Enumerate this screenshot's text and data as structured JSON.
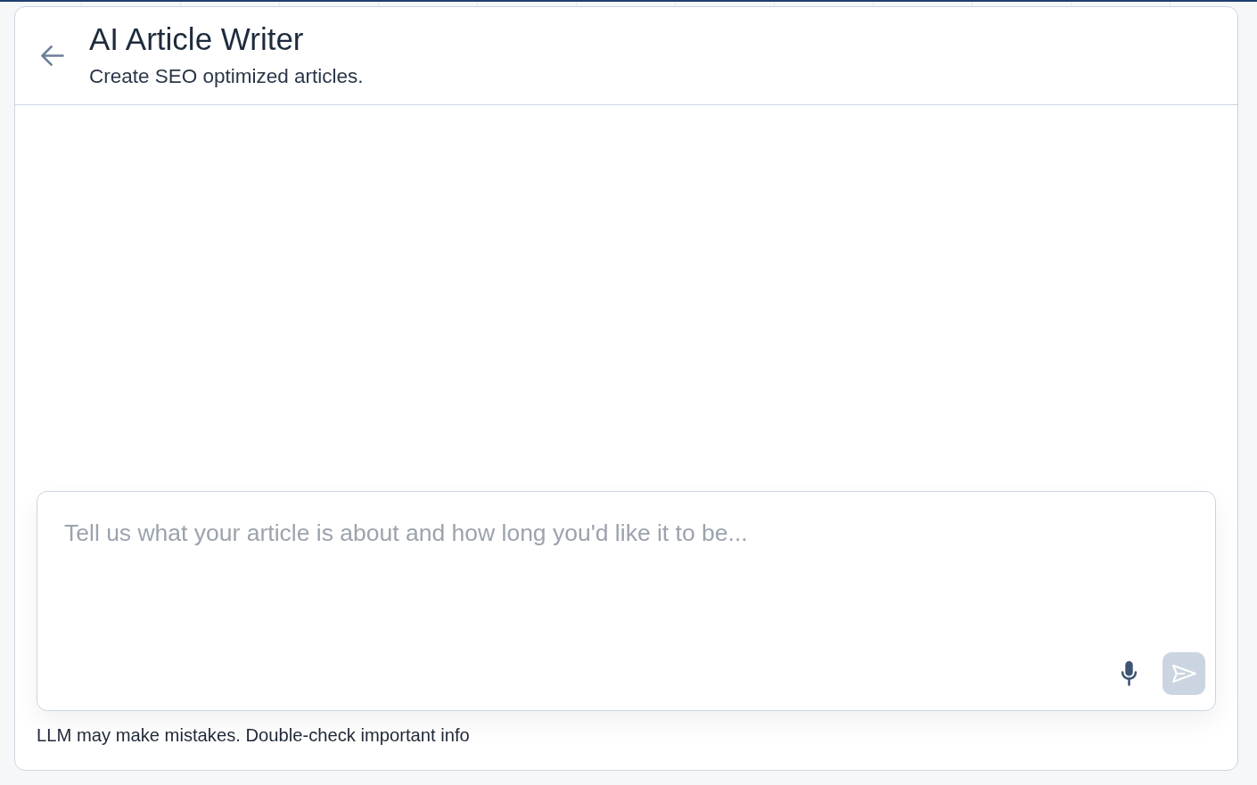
{
  "header": {
    "title": "AI Article Writer",
    "subtitle": "Create SEO optimized articles."
  },
  "composer": {
    "placeholder": "Tell us what your article is about and how long you'd like it to be...",
    "send_button": {
      "disabled": true
    }
  },
  "disclaimer": "LLM may make mistakes. Double-check important info"
}
